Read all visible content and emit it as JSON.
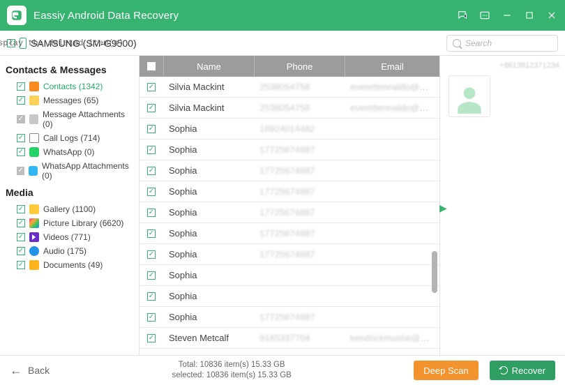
{
  "app": {
    "title": "Eassiy Android Data Recovery"
  },
  "device": {
    "label": "SAMSUNG (SM-G9500)"
  },
  "toggle": {
    "state": "OFF",
    "label": "Only display the deleted item(s)"
  },
  "search": {
    "placeholder": "Search"
  },
  "sidebar": {
    "group1": "Contacts & Messages",
    "group2": "Media",
    "items1": [
      {
        "label": "Contacts (1342)",
        "active": true,
        "icon": "icon-contacts"
      },
      {
        "label": "Messages (65)",
        "icon": "icon-messages"
      },
      {
        "label": "Message Attachments (0)",
        "icon": "icon-attach",
        "gray": true
      },
      {
        "label": "Call Logs (714)",
        "icon": "icon-calls"
      },
      {
        "label": "WhatsApp (0)",
        "icon": "icon-whatsapp"
      },
      {
        "label": "WhatsApp Attachments (0)",
        "icon": "icon-whatsapp2",
        "gray": true
      }
    ],
    "items2": [
      {
        "label": "Gallery (1100)",
        "icon": "icon-gallery"
      },
      {
        "label": "Picture Library (6620)",
        "icon": "icon-piclib"
      },
      {
        "label": "Videos (771)",
        "icon": "icon-videos"
      },
      {
        "label": "Audio (175)",
        "icon": "icon-audio"
      },
      {
        "label": "Documents (49)",
        "icon": "icon-docs"
      }
    ]
  },
  "table": {
    "headers": {
      "name": "Name",
      "phone": "Phone",
      "email": "Email"
    },
    "rows": [
      {
        "name": "Silvia Mackint",
        "phone": "2538054758",
        "email_blur": "everettennaldo@msn",
        "email_clear": ".com"
      },
      {
        "name": "Silvia Mackint",
        "phone": "2538054758",
        "email_blur": "everettennaldo@msn",
        "email_clear": ".com"
      },
      {
        "name": "Sophia",
        "phone": "18924014482"
      },
      {
        "name": "Sophia",
        "phone": "17725674887"
      },
      {
        "name": "Sophia",
        "phone": "17725674887"
      },
      {
        "name": "Sophia",
        "phone": "17725674887"
      },
      {
        "name": "Sophia",
        "phone": "17725674887"
      },
      {
        "name": "Sophia",
        "phone": "17725674887"
      },
      {
        "name": "Sophia",
        "phone": "17725674887"
      },
      {
        "name": "Sophia",
        "phone": ""
      },
      {
        "name": "Sophia",
        "phone": ""
      },
      {
        "name": "Sophia",
        "phone": "17725674887"
      },
      {
        "name": "Steven Metcalf",
        "phone": "9185337704",
        "email_blur": "kendrickmushe@gmail",
        "email_clear": ".com"
      }
    ]
  },
  "detail": {
    "number": "+8613812371234"
  },
  "footer": {
    "back": "Back",
    "total_line": "Total: 10836 item(s) 15.33 GB",
    "selected_line": "selected: 10836 item(s) 15.33 GB",
    "deepscan": "Deep Scan",
    "recover": "Recover"
  }
}
